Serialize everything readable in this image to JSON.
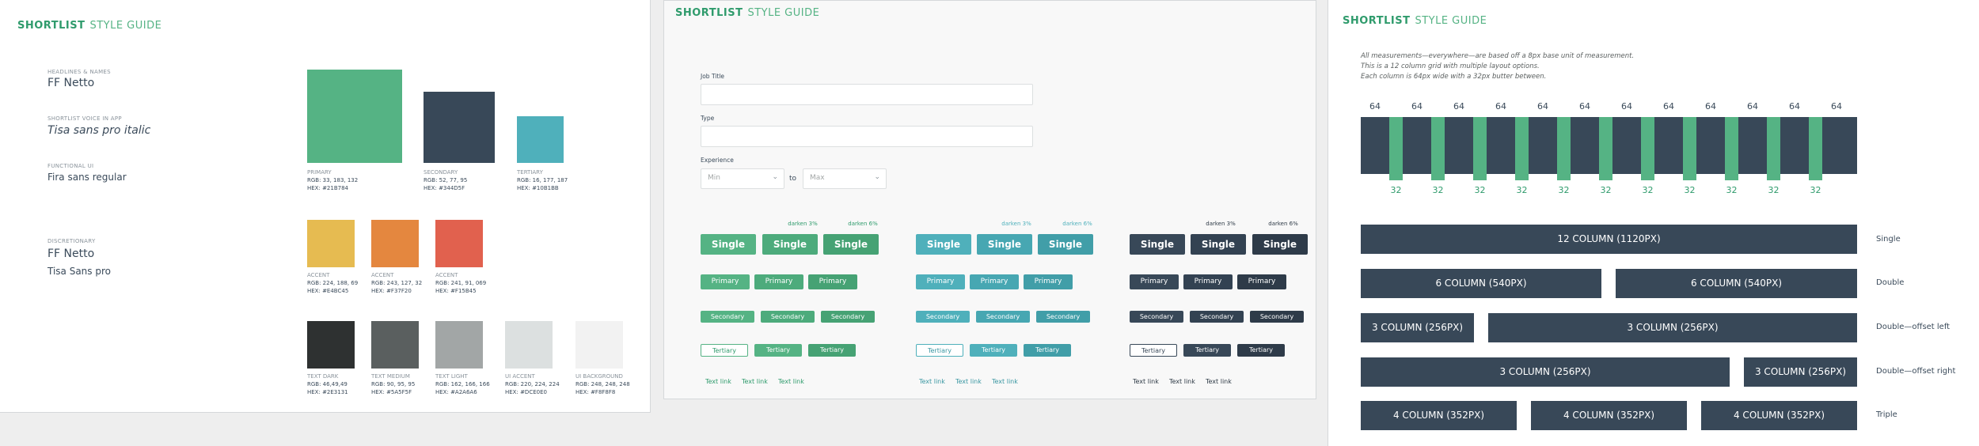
{
  "colors": {
    "primary": "#2f9b6c",
    "secondary": "#384858",
    "tertiary": "#4fb3bc",
    "accent_yellow": "#e6bb51",
    "accent_orange": "#e4873f",
    "accent_red": "#e1614e",
    "text_dark": "#2e3131",
    "text_medium": "#5a5f5f",
    "text_light": "#a2a6a6",
    "ui_accent": "#dce0e0",
    "ui_background": "#f8f8f8"
  },
  "panel1": {
    "brand": "SHORTLIST",
    "brand2": "STYLE GUIDE",
    "fonts": [
      {
        "caption": "HEADLINES & NAMES",
        "name": "FF Netto"
      },
      {
        "caption": "SHORTLIST VOICE IN APP",
        "name": "Tisa sans pro italic"
      },
      {
        "caption": "FUNCTIONAL UI",
        "name": "Fira sans regular"
      },
      {
        "caption": "DISCRETIONARY",
        "name": "FF Netto",
        "name2": "Tisa Sans pro"
      }
    ],
    "swatches": [
      {
        "label": "PRIMARY",
        "rgb": "RGB: 33, 183, 132",
        "hex": "HEX: #21B784"
      },
      {
        "label": "SECONDARY",
        "rgb": "RGB: 52, 77, 95",
        "hex": "HEX: #344D5F"
      },
      {
        "label": "TERTIARY",
        "rgb": "RGB: 16, 177, 187",
        "hex": "HEX: #10B1BB"
      },
      {
        "label": "ACCENT",
        "rgb": "RGB: 224, 188, 69",
        "hex": "HEX: #E4BC45"
      },
      {
        "label": "ACCENT",
        "rgb": "RGB: 243, 127, 32",
        "hex": "HEX: #F37F20"
      },
      {
        "label": "ACCENT",
        "rgb": "RGB: 241, 91, 069",
        "hex": "HEX: #F15B45"
      },
      {
        "label": "TEXT DARK",
        "rgb": "RGB: 46,49,49",
        "hex": "HEX: #2E3131"
      },
      {
        "label": "TEXT MEDIUM",
        "rgb": "RGB: 90, 95, 95",
        "hex": "HEX: #5A5F5F"
      },
      {
        "label": "TEXT LIGHT",
        "rgb": "RGB: 162, 166, 166",
        "hex": "HEX: #A2A6A6"
      },
      {
        "label": "UI ACCENT",
        "rgb": "RGB: 220, 224, 224",
        "hex": "HEX: #DCE0E0"
      },
      {
        "label": "UI BACKGROUND",
        "rgb": "RGB: 248, 248, 248",
        "hex": "HEX: #F8F8F8"
      }
    ]
  },
  "panel2": {
    "brand": "SHORTLIST",
    "brand2": "STYLE GUIDE",
    "job_title_label": "Job Title",
    "type_label": "Type",
    "experience_label": "Experience",
    "min_placeholder": "Min",
    "to_label": "to",
    "max_placeholder": "Max",
    "darken3": "darken 3%",
    "darken6": "darken 6%",
    "single": "Single",
    "primary": "Primary",
    "secondary": "Secondary",
    "tertiary": "Tertiary",
    "textlink": "Text link"
  },
  "panel3": {
    "brand": "SHORTLIST",
    "brand2": "STYLE GUIDE",
    "desc1": "All measurements—everywhere—are based off a 8px base unit of measurement.",
    "desc2": "This is a 12 column grid with multiple layout options.",
    "desc3": "Each column is 64px wide with a 32px  butter between.",
    "col_width": "64",
    "gutter_width": "32",
    "single_bar": "12 COLUMN (1120PX)",
    "double_bar": "6 COLUMN (540PX)",
    "offset_small": "3 COLUMN (256PX)",
    "triple_bar": "4 COLUMN (352PX)",
    "row_single": "Single",
    "row_double": "Double",
    "row_offset_left": "Double—offset left",
    "row_offset_right": "Double—offset right",
    "row_triple": "Triple"
  }
}
